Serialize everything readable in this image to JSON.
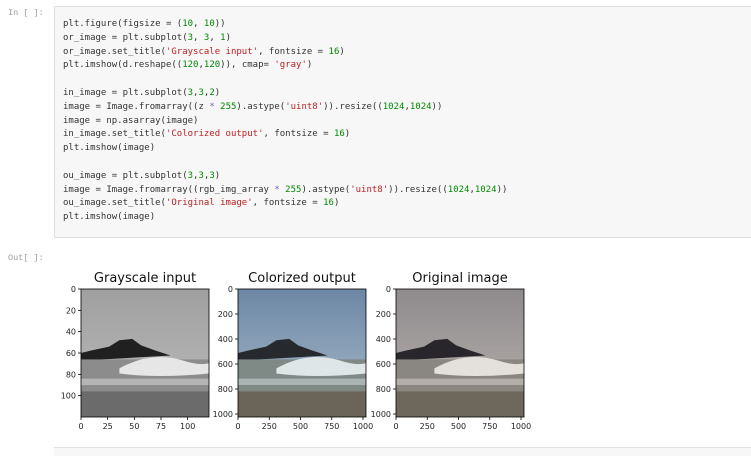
{
  "input_cell": {
    "prompt": "In [ ]:",
    "code_lines": [
      [
        {
          "t": "plt.figure(figsize = ("
        },
        {
          "t": "10",
          "k": "num"
        },
        {
          "t": ", "
        },
        {
          "t": "10",
          "k": "num"
        },
        {
          "t": "))"
        }
      ],
      [
        {
          "t": "or_image = plt.subplot("
        },
        {
          "t": "3",
          "k": "num"
        },
        {
          "t": ", "
        },
        {
          "t": "3",
          "k": "num"
        },
        {
          "t": ", "
        },
        {
          "t": "1",
          "k": "num"
        },
        {
          "t": ")"
        }
      ],
      [
        {
          "t": "or_image.set_title("
        },
        {
          "t": "'Grayscale input'",
          "k": "str"
        },
        {
          "t": ", fontsize = "
        },
        {
          "t": "16",
          "k": "num"
        },
        {
          "t": ")"
        }
      ],
      [
        {
          "t": "plt.imshow(d.reshape(("
        },
        {
          "t": "120",
          "k": "num"
        },
        {
          "t": ","
        },
        {
          "t": "120",
          "k": "num"
        },
        {
          "t": ")), cmap= "
        },
        {
          "t": "'gray'",
          "k": "str"
        },
        {
          "t": ")"
        }
      ],
      [],
      [
        {
          "t": "in_image = plt.subplot("
        },
        {
          "t": "3",
          "k": "num"
        },
        {
          "t": ","
        },
        {
          "t": "3",
          "k": "num"
        },
        {
          "t": ","
        },
        {
          "t": "2",
          "k": "num"
        },
        {
          "t": ")"
        }
      ],
      [
        {
          "t": "image = Image.fromarray((z "
        },
        {
          "t": "*",
          "k": "op"
        },
        {
          "t": " "
        },
        {
          "t": "255",
          "k": "num"
        },
        {
          "t": ").astype("
        },
        {
          "t": "'uint8'",
          "k": "str"
        },
        {
          "t": ")).resize(("
        },
        {
          "t": "1024",
          "k": "num"
        },
        {
          "t": ","
        },
        {
          "t": "1024",
          "k": "num"
        },
        {
          "t": "))"
        }
      ],
      [
        {
          "t": "image = np.asarray(image)"
        }
      ],
      [
        {
          "t": "in_image.set_title("
        },
        {
          "t": "'Colorized output'",
          "k": "str"
        },
        {
          "t": ", fontsize = "
        },
        {
          "t": "16",
          "k": "num"
        },
        {
          "t": ")"
        }
      ],
      [
        {
          "t": "plt.imshow(image)"
        }
      ],
      [],
      [
        {
          "t": "ou_image = plt.subplot("
        },
        {
          "t": "3",
          "k": "num"
        },
        {
          "t": ","
        },
        {
          "t": "3",
          "k": "num"
        },
        {
          "t": ","
        },
        {
          "t": "3",
          "k": "num"
        },
        {
          "t": ")"
        }
      ],
      [
        {
          "t": "image = Image.fromarray((rgb_img_array "
        },
        {
          "t": "*",
          "k": "op"
        },
        {
          "t": " "
        },
        {
          "t": "255",
          "k": "num"
        },
        {
          "t": ").astype("
        },
        {
          "t": "'uint8'",
          "k": "str"
        },
        {
          "t": ")).resize(("
        },
        {
          "t": "1024",
          "k": "num"
        },
        {
          "t": ","
        },
        {
          "t": "1024",
          "k": "num"
        },
        {
          "t": "))"
        }
      ],
      [
        {
          "t": "ou_image.set_title("
        },
        {
          "t": "'Original image'",
          "k": "str"
        },
        {
          "t": ", fontsize = "
        },
        {
          "t": "16",
          "k": "num"
        },
        {
          "t": ")"
        }
      ],
      [
        {
          "t": "plt.imshow(image)"
        }
      ]
    ]
  },
  "output_cell": {
    "prompt": "Out[ ]:",
    "subplots": [
      {
        "title": "Grayscale input",
        "image_palette": {
          "sky": "#bdbdbd",
          "sky_top": "#9f9f9f",
          "rock": "#202020",
          "sea": "#8c8c8c",
          "foam": "#e6e6e6",
          "sand": "#6b6b6b"
        },
        "xticks": [
          0,
          25,
          50,
          75,
          100
        ],
        "yticks": [
          0,
          20,
          40,
          60,
          80,
          100
        ],
        "xlim": [
          0,
          120
        ],
        "ylim": [
          0,
          120
        ]
      },
      {
        "title": "Colorized output",
        "image_palette": {
          "sky": "#a9bccc",
          "sky_top": "#6d87a4",
          "rock": "#262a2e",
          "sea": "#7f8a86",
          "foam": "#dfe6e8",
          "sand": "#6a6558"
        },
        "xticks": [
          0,
          250,
          500,
          750,
          1000
        ],
        "yticks": [
          0,
          200,
          400,
          600,
          800,
          1000
        ],
        "xlim": [
          0,
          1024
        ],
        "ylim": [
          0,
          1024
        ]
      },
      {
        "title": "Original image",
        "image_palette": {
          "sky": "#b9b4ae",
          "sky_top": "#8e8a8d",
          "rock": "#28262a",
          "sea": "#8a8681",
          "foam": "#e4e1dc",
          "sand": "#6e675c"
        },
        "xticks": [
          0,
          250,
          500,
          750,
          1000
        ],
        "yticks": [
          0,
          200,
          400,
          600,
          800,
          1000
        ],
        "xlim": [
          0,
          1024
        ],
        "ylim": [
          0,
          1024
        ]
      }
    ]
  }
}
